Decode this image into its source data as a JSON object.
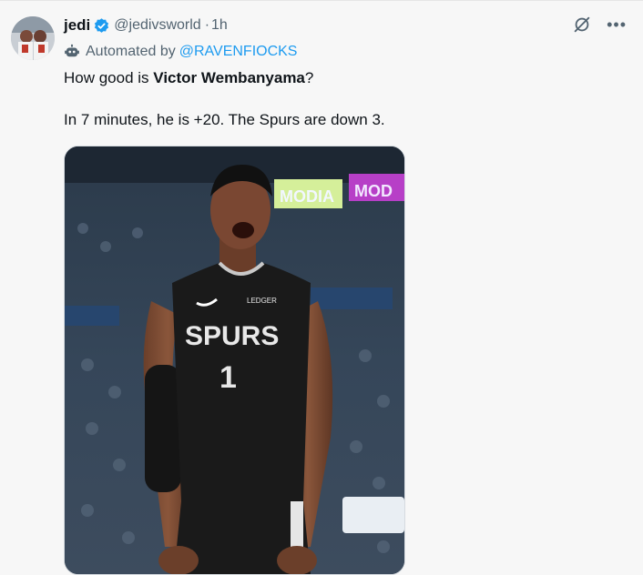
{
  "author": {
    "display_name": "jedi",
    "handle": "@jedivsworld",
    "separator": "·",
    "time": "1h"
  },
  "automated": {
    "label": "Automated by",
    "account": "@RAVENFIOCKS"
  },
  "tweet": {
    "line1_prefix": "How good is ",
    "line1_bold": "Victor Wembanyama",
    "line1_suffix": "?",
    "line2": "In 7 minutes, he is +20. The Spurs are down 3."
  },
  "media": {
    "jersey_team": "SPURS",
    "jersey_number": "1",
    "jersey_patch": "LEDGER",
    "board_text_1": "MODIA",
    "board_text_2": "MOD"
  },
  "icons": {
    "verified": "verified-badge-icon",
    "automated": "bot-icon",
    "grok": "grok-icon",
    "more": "more-icon"
  },
  "colors": {
    "verified": "#1d9bf0",
    "link": "#1d9bf0",
    "secondary_text": "#536471"
  }
}
